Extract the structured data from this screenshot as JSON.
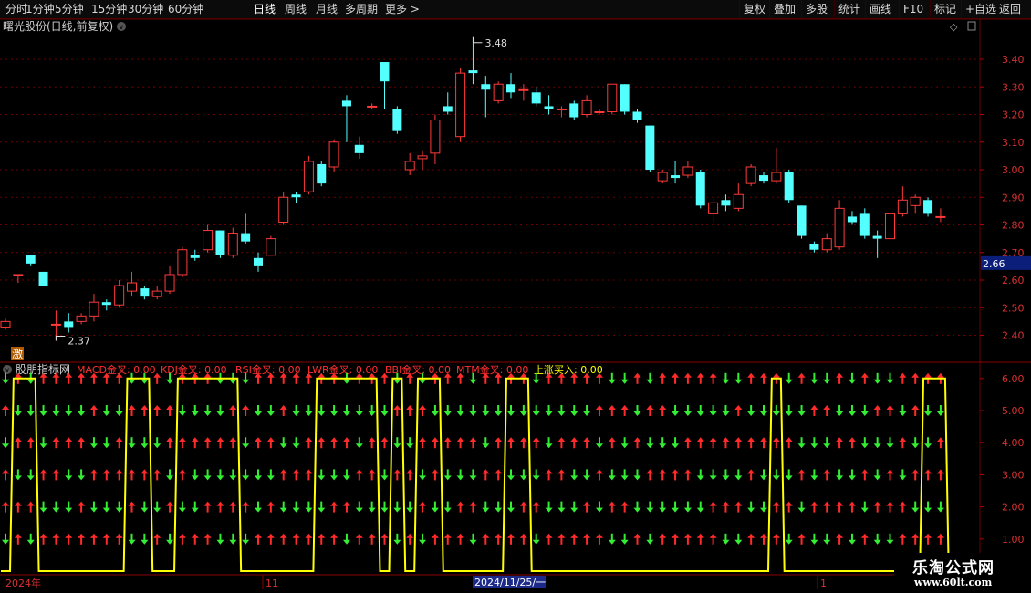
{
  "toolbar": {
    "left_items": [
      "分时",
      "1分钟",
      "5分钟",
      "15分钟",
      "30分钟",
      "60分钟",
      "日线",
      "周线",
      "月线",
      "多周期",
      "更多 >"
    ],
    "active": "日线",
    "right_items": [
      "复权",
      "叠加",
      "多股",
      "统计",
      "画线",
      "F10",
      "标记",
      "+自选",
      "返回"
    ]
  },
  "main": {
    "title": "曙光股份(日线,前复权)",
    "max_label": "3.48",
    "min_label": "2.37",
    "current_price": "2.66",
    "badge": "激",
    "y_ticks": [
      "3.40",
      "3.30",
      "3.20",
      "3.10",
      "3.00",
      "2.90",
      "2.80",
      "2.70",
      "2.60",
      "2.50",
      "2.40"
    ]
  },
  "indicator": {
    "name": "股朋指标网",
    "items": [
      {
        "label": "MACD金叉: 0.00",
        "color": "#ff3030"
      },
      {
        "label": "KDJ金叉: 0.00",
        "color": "#ff3030"
      },
      {
        "label": "RSI金叉: 0.00",
        "color": "#ff3030"
      },
      {
        "label": "LWR金叉: 0.00",
        "color": "#ff3030"
      },
      {
        "label": "BBI金叉: 0.00",
        "color": "#ff3030"
      },
      {
        "label": "MTM金叉: 0.00",
        "color": "#ff3030"
      },
      {
        "label": "上涨买入: 0.00",
        "color": "#ffff00"
      }
    ],
    "y_ticks": [
      "6.00",
      "5.00",
      "4.00",
      "3.00",
      "2.00",
      "1.00"
    ]
  },
  "bottom_axis": {
    "labels": [
      "2024年",
      "11",
      "2024/11/25/一",
      "1"
    ]
  },
  "watermark": {
    "line1": "乐淘公式网",
    "line2": "www.60lt.com"
  },
  "colors": {
    "up": "#ff3a3a",
    "down": "#54ffff",
    "bg": "#000000",
    "grid": "#6a0000",
    "line": "#ffff00",
    "arrow_down": "#33ee33"
  },
  "chart_data": {
    "type": "candlestick",
    "candles": [
      {
        "o": 2.43,
        "c": 2.45,
        "h": 2.46,
        "l": 2.42
      },
      {
        "o": 2.62,
        "c": 2.62,
        "h": 2.62,
        "l": 2.59
      },
      {
        "o": 2.69,
        "c": 2.66,
        "h": 2.69,
        "l": 2.65
      },
      {
        "o": 2.63,
        "c": 2.58,
        "h": 2.63,
        "l": 2.58
      },
      {
        "o": 2.44,
        "c": 2.44,
        "h": 2.49,
        "l": 2.38
      },
      {
        "o": 2.45,
        "c": 2.43,
        "h": 2.48,
        "l": 2.41
      },
      {
        "o": 2.45,
        "c": 2.47,
        "h": 2.48,
        "l": 2.44
      },
      {
        "o": 2.47,
        "c": 2.52,
        "h": 2.55,
        "l": 2.45
      },
      {
        "o": 2.52,
        "c": 2.51,
        "h": 2.53,
        "l": 2.49
      },
      {
        "o": 2.51,
        "c": 2.58,
        "h": 2.6,
        "l": 2.5
      },
      {
        "o": 2.56,
        "c": 2.59,
        "h": 2.63,
        "l": 2.54
      },
      {
        "o": 2.57,
        "c": 2.54,
        "h": 2.58,
        "l": 2.53
      },
      {
        "o": 2.54,
        "c": 2.56,
        "h": 2.58,
        "l": 2.53
      },
      {
        "o": 2.56,
        "c": 2.62,
        "h": 2.65,
        "l": 2.55
      },
      {
        "o": 2.62,
        "c": 2.71,
        "h": 2.72,
        "l": 2.61
      },
      {
        "o": 2.69,
        "c": 2.68,
        "h": 2.71,
        "l": 2.67
      },
      {
        "o": 2.71,
        "c": 2.78,
        "h": 2.8,
        "l": 2.7
      },
      {
        "o": 2.78,
        "c": 2.69,
        "h": 2.78,
        "l": 2.68
      },
      {
        "o": 2.69,
        "c": 2.77,
        "h": 2.79,
        "l": 2.68
      },
      {
        "o": 2.77,
        "c": 2.74,
        "h": 2.84,
        "l": 2.73
      },
      {
        "o": 2.68,
        "c": 2.65,
        "h": 2.7,
        "l": 2.63
      },
      {
        "o": 2.69,
        "c": 2.75,
        "h": 2.76,
        "l": 2.69
      },
      {
        "o": 2.81,
        "c": 2.9,
        "h": 2.92,
        "l": 2.8
      },
      {
        "o": 2.91,
        "c": 2.9,
        "h": 2.92,
        "l": 2.88
      },
      {
        "o": 2.92,
        "c": 3.03,
        "h": 3.05,
        "l": 2.91
      },
      {
        "o": 3.02,
        "c": 2.95,
        "h": 3.03,
        "l": 2.94
      },
      {
        "o": 3.01,
        "c": 3.1,
        "h": 3.11,
        "l": 2.99
      },
      {
        "o": 3.25,
        "c": 3.23,
        "h": 3.27,
        "l": 3.1
      },
      {
        "o": 3.09,
        "c": 3.06,
        "h": 3.12,
        "l": 3.04
      },
      {
        "o": 3.23,
        "c": 3.23,
        "h": 3.24,
        "l": 3.22
      },
      {
        "o": 3.39,
        "c": 3.32,
        "h": 3.39,
        "l": 3.22
      },
      {
        "o": 3.22,
        "c": 3.14,
        "h": 3.23,
        "l": 3.13
      },
      {
        "o": 3.0,
        "c": 3.03,
        "h": 3.06,
        "l": 2.98
      },
      {
        "o": 3.04,
        "c": 3.05,
        "h": 3.07,
        "l": 3.0
      },
      {
        "o": 3.06,
        "c": 3.18,
        "h": 3.2,
        "l": 3.02
      },
      {
        "o": 3.23,
        "c": 3.21,
        "h": 3.28,
        "l": 3.2
      },
      {
        "o": 3.12,
        "c": 3.35,
        "h": 3.37,
        "l": 3.1
      },
      {
        "o": 3.36,
        "c": 3.35,
        "h": 3.48,
        "l": 3.31
      },
      {
        "o": 3.31,
        "c": 3.29,
        "h": 3.34,
        "l": 3.19
      },
      {
        "o": 3.25,
        "c": 3.31,
        "h": 3.32,
        "l": 3.24
      },
      {
        "o": 3.31,
        "c": 3.28,
        "h": 3.35,
        "l": 3.26
      },
      {
        "o": 3.29,
        "c": 3.29,
        "h": 3.31,
        "l": 3.25
      },
      {
        "o": 3.28,
        "c": 3.24,
        "h": 3.3,
        "l": 3.23
      },
      {
        "o": 3.23,
        "c": 3.22,
        "h": 3.27,
        "l": 3.2
      },
      {
        "o": 3.22,
        "c": 3.22,
        "h": 3.23,
        "l": 3.19
      },
      {
        "o": 3.24,
        "c": 3.19,
        "h": 3.25,
        "l": 3.18
      },
      {
        "o": 3.2,
        "c": 3.25,
        "h": 3.27,
        "l": 3.19
      },
      {
        "o": 3.21,
        "c": 3.21,
        "h": 3.22,
        "l": 3.2
      },
      {
        "o": 3.21,
        "c": 3.31,
        "h": 3.31,
        "l": 3.2
      },
      {
        "o": 3.31,
        "c": 3.21,
        "h": 3.31,
        "l": 3.2
      },
      {
        "o": 3.21,
        "c": 3.18,
        "h": 3.22,
        "l": 3.17
      },
      {
        "o": 3.16,
        "c": 3.0,
        "h": 3.16,
        "l": 2.99
      },
      {
        "o": 2.96,
        "c": 2.99,
        "h": 3.0,
        "l": 2.95
      },
      {
        "o": 2.98,
        "c": 2.97,
        "h": 3.03,
        "l": 2.95
      },
      {
        "o": 2.98,
        "c": 3.01,
        "h": 3.03,
        "l": 2.97
      },
      {
        "o": 2.99,
        "c": 2.87,
        "h": 3.0,
        "l": 2.86
      },
      {
        "o": 2.84,
        "c": 2.88,
        "h": 2.9,
        "l": 2.81
      },
      {
        "o": 2.89,
        "c": 2.87,
        "h": 2.91,
        "l": 2.85
      },
      {
        "o": 2.86,
        "c": 2.91,
        "h": 2.95,
        "l": 2.85
      },
      {
        "o": 2.95,
        "c": 3.01,
        "h": 3.02,
        "l": 2.94
      },
      {
        "o": 2.98,
        "c": 2.96,
        "h": 2.99,
        "l": 2.95
      },
      {
        "o": 2.96,
        "c": 2.99,
        "h": 3.08,
        "l": 2.95
      },
      {
        "o": 2.99,
        "c": 2.89,
        "h": 3.0,
        "l": 2.88
      },
      {
        "o": 2.87,
        "c": 2.76,
        "h": 2.87,
        "l": 2.75
      },
      {
        "o": 2.73,
        "c": 2.71,
        "h": 2.74,
        "l": 2.7
      },
      {
        "o": 2.71,
        "c": 2.75,
        "h": 2.77,
        "l": 2.7
      },
      {
        "o": 2.72,
        "c": 2.86,
        "h": 2.89,
        "l": 2.71
      },
      {
        "o": 2.83,
        "c": 2.81,
        "h": 2.85,
        "l": 2.8
      },
      {
        "o": 2.84,
        "c": 2.76,
        "h": 2.86,
        "l": 2.75
      },
      {
        "o": 2.76,
        "c": 2.75,
        "h": 2.78,
        "l": 2.68
      },
      {
        "o": 2.75,
        "c": 2.84,
        "h": 2.85,
        "l": 2.74
      },
      {
        "o": 2.84,
        "c": 2.89,
        "h": 2.94,
        "l": 2.83
      },
      {
        "o": 2.87,
        "c": 2.9,
        "h": 2.91,
        "l": 2.84
      },
      {
        "o": 2.89,
        "c": 2.84,
        "h": 2.9,
        "l": 2.83
      },
      {
        "o": 2.83,
        "c": 2.83,
        "h": 2.86,
        "l": 2.81
      }
    ],
    "indicator_line": [
      0,
      6,
      6,
      0,
      0,
      0,
      0,
      0,
      0,
      0,
      6,
      6,
      0,
      0,
      6,
      6,
      6,
      6,
      6,
      0,
      0,
      0,
      0,
      0,
      0,
      6,
      6,
      6,
      6,
      6,
      0,
      6,
      0,
      6,
      6,
      0,
      0,
      0,
      0,
      0,
      6,
      6,
      0,
      0,
      0,
      0,
      0,
      0,
      0,
      0,
      0,
      0,
      0,
      0,
      0,
      0,
      0,
      0,
      0,
      0,
      0,
      6,
      0,
      0,
      0,
      0,
      0,
      0,
      0,
      0,
      0,
      0,
      0,
      6,
      6,
      0,
      0
    ]
  }
}
